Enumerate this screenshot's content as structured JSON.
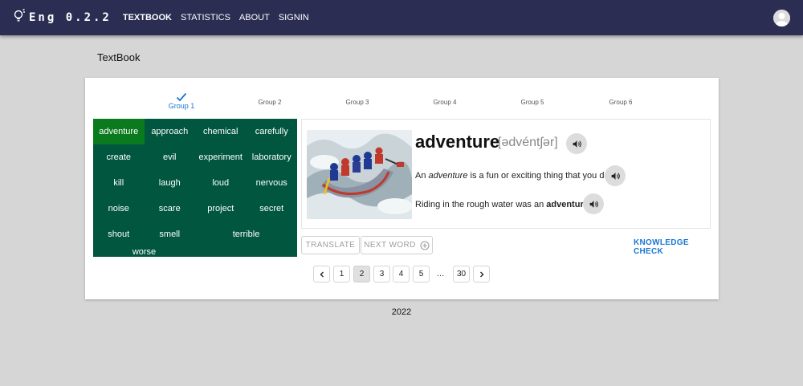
{
  "app": {
    "brand": "Eng 0.2.2"
  },
  "nav": [
    "TEXTBOOK",
    "STATISTICS",
    "ABOUT",
    "SIGNIN"
  ],
  "page_title": "TextBook",
  "groups": [
    "Group 1",
    "Group 2",
    "Group 3",
    "Group 4",
    "Group 5",
    "Group 6"
  ],
  "selected_group": "Group 1",
  "words": [
    "adventure",
    "approach",
    "chemical",
    "carefully",
    "create",
    "evil",
    "experiment",
    "laboratory",
    "kill",
    "laugh",
    "loud",
    "nervous",
    "noise",
    "scare",
    "project",
    "secret",
    "shout",
    "smell",
    "terrible",
    "worse"
  ],
  "selected_word": "adventure",
  "word_card": {
    "word": "adventure",
    "transcription": "[ədvéntʃər]",
    "meaning": {
      "before": "An ",
      "word": "adventure",
      "after": " is a fun or exciting thing that you do."
    },
    "example": {
      "before": "Riding in the rough water was an ",
      "word": "adventure",
      "after": "."
    }
  },
  "buttons": {
    "translate": "TRANSLATE",
    "next_word": "NEXT WORD",
    "knowledge_check": "KNOWLEDGE CHECK"
  },
  "pagination": {
    "pages": [
      "1",
      "2",
      "3",
      "4",
      "5",
      "…",
      "30"
    ],
    "current": "2"
  },
  "footer": {
    "year": "2022"
  },
  "colors": {
    "appbar": "#2b2d52",
    "word_grid": "#00563f",
    "word_selected": "#0a7a1e",
    "accent": "#1976d2"
  },
  "icons": [
    "lightbulb-icon",
    "check-icon",
    "volume-icon",
    "plus-circle-icon",
    "chevron-left-icon",
    "chevron-right-icon",
    "avatar-icon"
  ]
}
